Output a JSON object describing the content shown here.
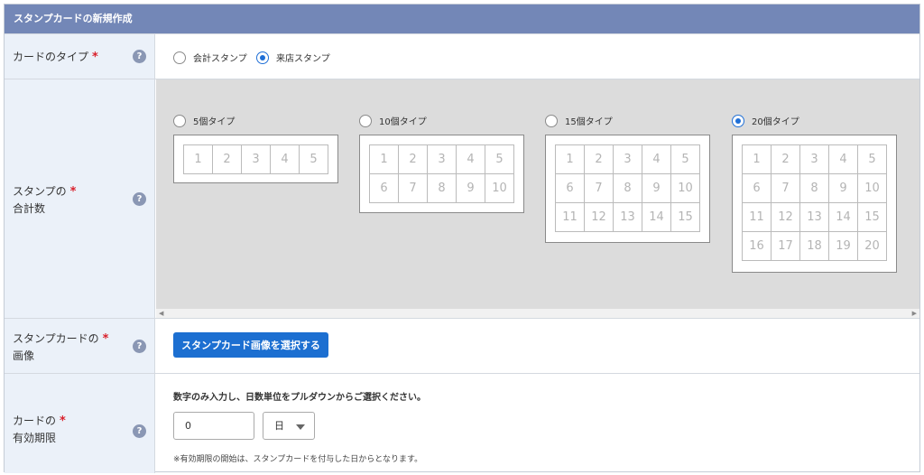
{
  "header": {
    "title": "スタンプカードの新規作成"
  },
  "help_glyph": "?",
  "required_mark": "*",
  "card_type": {
    "label": "カードのタイプ",
    "options": [
      {
        "label": "会計スタンプ",
        "selected": false
      },
      {
        "label": "来店スタンプ",
        "selected": true
      }
    ]
  },
  "stamp_total": {
    "label_line1": "スタンプの",
    "label_line2": "合計数",
    "options": [
      {
        "label": "5個タイプ",
        "selected": false,
        "cells": [
          "1",
          "2",
          "3",
          "4",
          "5"
        ]
      },
      {
        "label": "10個タイプ",
        "selected": false,
        "cells": [
          "1",
          "2",
          "3",
          "4",
          "5",
          "6",
          "7",
          "8",
          "9",
          "10"
        ]
      },
      {
        "label": "15個タイプ",
        "selected": false,
        "cells": [
          "1",
          "2",
          "3",
          "4",
          "5",
          "6",
          "7",
          "8",
          "9",
          "10",
          "11",
          "12",
          "13",
          "14",
          "15"
        ]
      },
      {
        "label": "20個タイプ",
        "selected": true,
        "cells": [
          "1",
          "2",
          "3",
          "4",
          "5",
          "6",
          "7",
          "8",
          "9",
          "10",
          "11",
          "12",
          "13",
          "14",
          "15",
          "16",
          "17",
          "18",
          "19",
          "20"
        ]
      }
    ],
    "scroll_left": "◀",
    "scroll_right": "▶"
  },
  "stamp_image": {
    "label_line1": "スタンプカードの",
    "label_line2": "画像",
    "button_label": "スタンプカード画像を選択する"
  },
  "expiry": {
    "label_line1": "カードの",
    "label_line2": "有効期限",
    "instruction": "数字のみ入力し、日数単位をプルダウンからご選択ください。",
    "number_value": "0",
    "unit_value": "日",
    "note": "※有効期限の開始は、スタンプカードを付与した日からとなります。"
  }
}
